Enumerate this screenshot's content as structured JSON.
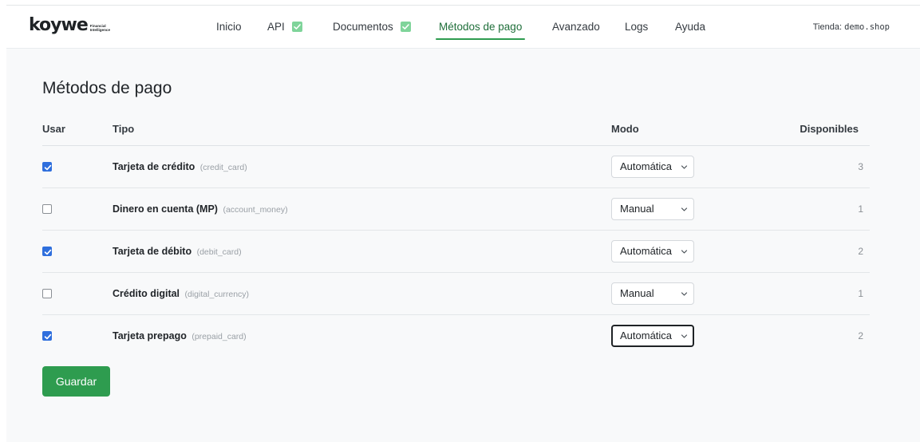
{
  "brand": {
    "name": "koywe",
    "tagline": "Financial Intelligence"
  },
  "nav": {
    "items": [
      {
        "label": "Inicio"
      },
      {
        "label": "API",
        "badge": "check"
      },
      {
        "label": "Documentos",
        "badge": "check"
      },
      {
        "label": "Métodos de pago",
        "active": true
      },
      {
        "label": "Avanzado"
      },
      {
        "label": "Logs"
      },
      {
        "label": "Ayuda"
      }
    ],
    "store_label": "Tienda:",
    "store_value": "demo.shop"
  },
  "page": {
    "title": "Métodos de pago"
  },
  "table": {
    "headers": {
      "use": "Usar",
      "type": "Tipo",
      "mode": "Modo",
      "available": "Disponibles"
    },
    "rows": [
      {
        "checked": true,
        "name": "Tarjeta de crédito",
        "code": "(credit_card)",
        "mode": "Automática",
        "available": "3"
      },
      {
        "checked": false,
        "name": "Dinero en cuenta (MP)",
        "code": "(account_money)",
        "mode": "Manual",
        "available": "1"
      },
      {
        "checked": true,
        "name": "Tarjeta de débito",
        "code": "(debit_card)",
        "mode": "Automática",
        "available": "2"
      },
      {
        "checked": false,
        "name": "Crédito digital",
        "code": "(digital_currency)",
        "mode": "Manual",
        "available": "1"
      },
      {
        "checked": true,
        "name": "Tarjeta prepago",
        "code": "(prepaid_card)",
        "mode": "Automática",
        "available": "2",
        "focused": true
      }
    ]
  },
  "actions": {
    "save_label": "Guardar"
  },
  "colors": {
    "accent": "#2e9c4f",
    "checkbox": "#2f6fdd",
    "badge": "#7fd49a"
  }
}
